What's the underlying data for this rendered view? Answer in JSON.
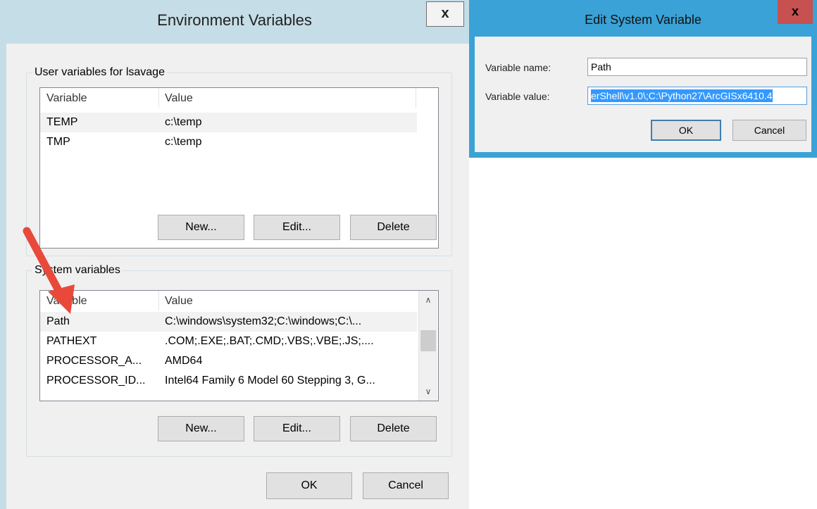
{
  "env_window": {
    "title": "Environment Variables",
    "close_glyph": "x",
    "user_group": {
      "label": "User variables for lsavage",
      "columns": [
        "Variable",
        "Value"
      ],
      "rows": [
        {
          "variable": "TEMP",
          "value": "c:\\temp"
        },
        {
          "variable": "TMP",
          "value": "c:\\temp"
        }
      ],
      "selected_row": 0,
      "buttons": {
        "new": "New...",
        "edit": "Edit...",
        "delete": "Delete"
      }
    },
    "system_group": {
      "label": "System variables",
      "columns": [
        "Variable",
        "Value"
      ],
      "rows": [
        {
          "variable": "Path",
          "value": "C:\\windows\\system32;C:\\windows;C:\\..."
        },
        {
          "variable": "PATHEXT",
          "value": ".COM;.EXE;.BAT;.CMD;.VBS;.VBE;.JS;...."
        },
        {
          "variable": "PROCESSOR_A...",
          "value": "AMD64"
        },
        {
          "variable": "PROCESSOR_ID...",
          "value": "Intel64 Family 6 Model 60 Stepping 3, G..."
        }
      ],
      "selected_row": 0,
      "buttons": {
        "new": "New...",
        "edit": "Edit...",
        "delete": "Delete"
      },
      "scroll_up_glyph": "∧",
      "scroll_down_glyph": "∨"
    },
    "footer": {
      "ok": "OK",
      "cancel": "Cancel"
    }
  },
  "edit_window": {
    "title": "Edit System Variable",
    "close_glyph": "x",
    "name_label": "Variable name:",
    "name_value": "Path",
    "value_label": "Variable value:",
    "value_value": "erShell\\v1.0\\;C:\\Python27\\ArcGISx6410.4",
    "ok": "OK",
    "cancel": "Cancel"
  },
  "annotation": {
    "arrow_color": "#e8493a",
    "arrow_icon": "red-arrow-pointing-to-path"
  },
  "colors": {
    "env_frame": "#c5dde6",
    "edit_frame": "#3aa2d6",
    "close_active": "#c75050",
    "selection": "#3399ff"
  }
}
